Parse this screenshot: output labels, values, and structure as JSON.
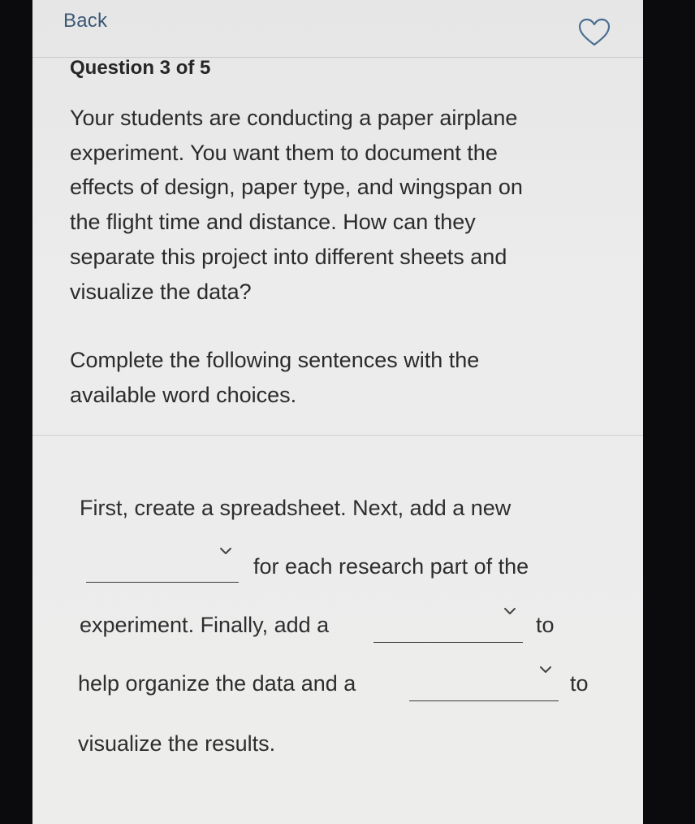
{
  "header": {
    "back_label": "Back",
    "favorite_icon": "heart-outline-icon"
  },
  "question": {
    "counter": "Question 3 of 5",
    "prompt_lines": [
      "Your students are conducting a paper airplane",
      "experiment. You want them to document the",
      "effects of design, paper type, and wingspan on",
      "the flight time and distance. How can they",
      "separate this project into different sheets and",
      "visualize the data?"
    ],
    "instruction_lines": [
      "Complete the following sentences with the",
      "available word choices."
    ]
  },
  "fill_in": {
    "line1": "First, create a spreadsheet. Next, add a new",
    "after_blank1": "for each research part of the",
    "before_blank2": "experiment. Finally, add a",
    "after_blank2": "to",
    "before_blank3": "help organize the data and a",
    "after_blank3": "to",
    "line5": "visualize the results.",
    "blank1_value": "",
    "blank2_value": "",
    "blank3_value": "",
    "dropdown_icon": "chevron-down-icon"
  },
  "colors": {
    "back_link": "#3c5875",
    "text": "#2b2b2b",
    "background": "#ececec"
  }
}
